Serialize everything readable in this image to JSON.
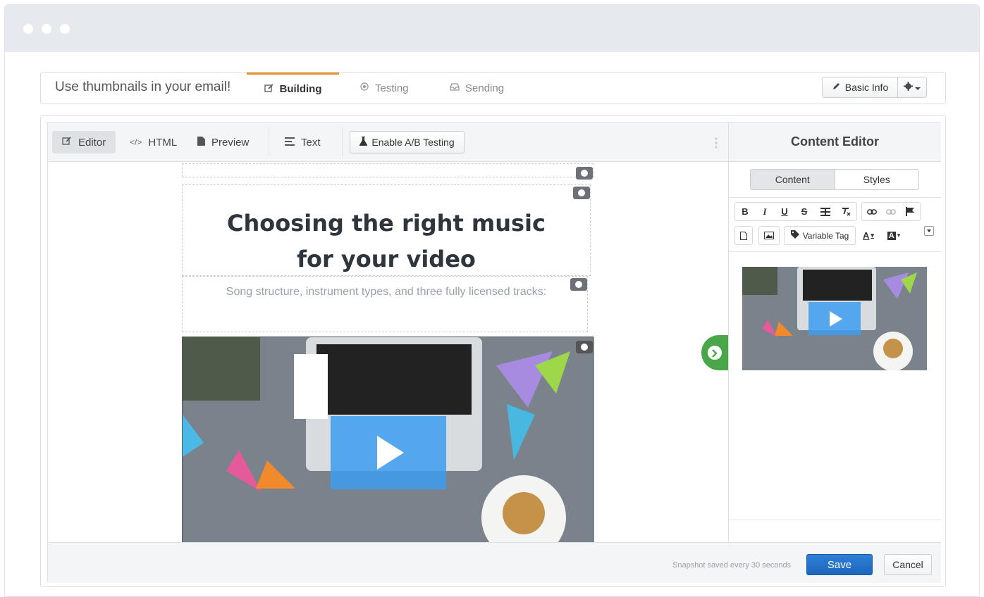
{
  "header": {
    "title": "Use thumbnails in your email!",
    "tabs": [
      {
        "label": "Building",
        "icon": "edit-icon"
      },
      {
        "label": "Testing",
        "icon": "target-icon"
      },
      {
        "label": "Sending",
        "icon": "inbox-icon"
      }
    ],
    "basic_info": "Basic Info",
    "settings_icon": "gear-icon"
  },
  "editor": {
    "tabs": [
      {
        "label": "Editor",
        "icon": "edit-icon"
      },
      {
        "label": "HTML",
        "icon": "code-icon"
      },
      {
        "label": "Preview",
        "icon": "file-icon"
      },
      {
        "label": "Text",
        "icon": "align-left-icon"
      }
    ],
    "ab_button": "Enable A/B Testing",
    "headline_line1": "Choosing the right music",
    "headline_line2": "for your video",
    "subhead": "Song structure, instrument types, and three fully licensed tracks:"
  },
  "content_editor": {
    "title": "Content Editor",
    "seg_content": "Content",
    "seg_styles": "Styles",
    "rte": {
      "bold": "B",
      "italic": "I",
      "underline": "U",
      "strike": "S",
      "variable_tag": "Variable Tag",
      "text_color": "A",
      "bg_color": "A"
    }
  },
  "footer": {
    "note": "Snapshot saved every 30 seconds",
    "save": "Save",
    "cancel": "Cancel"
  },
  "colors": {
    "accent_tab": "#e8912c",
    "save": "#1d66bd",
    "toggle": "#49a649",
    "play": "#3d9df0"
  }
}
